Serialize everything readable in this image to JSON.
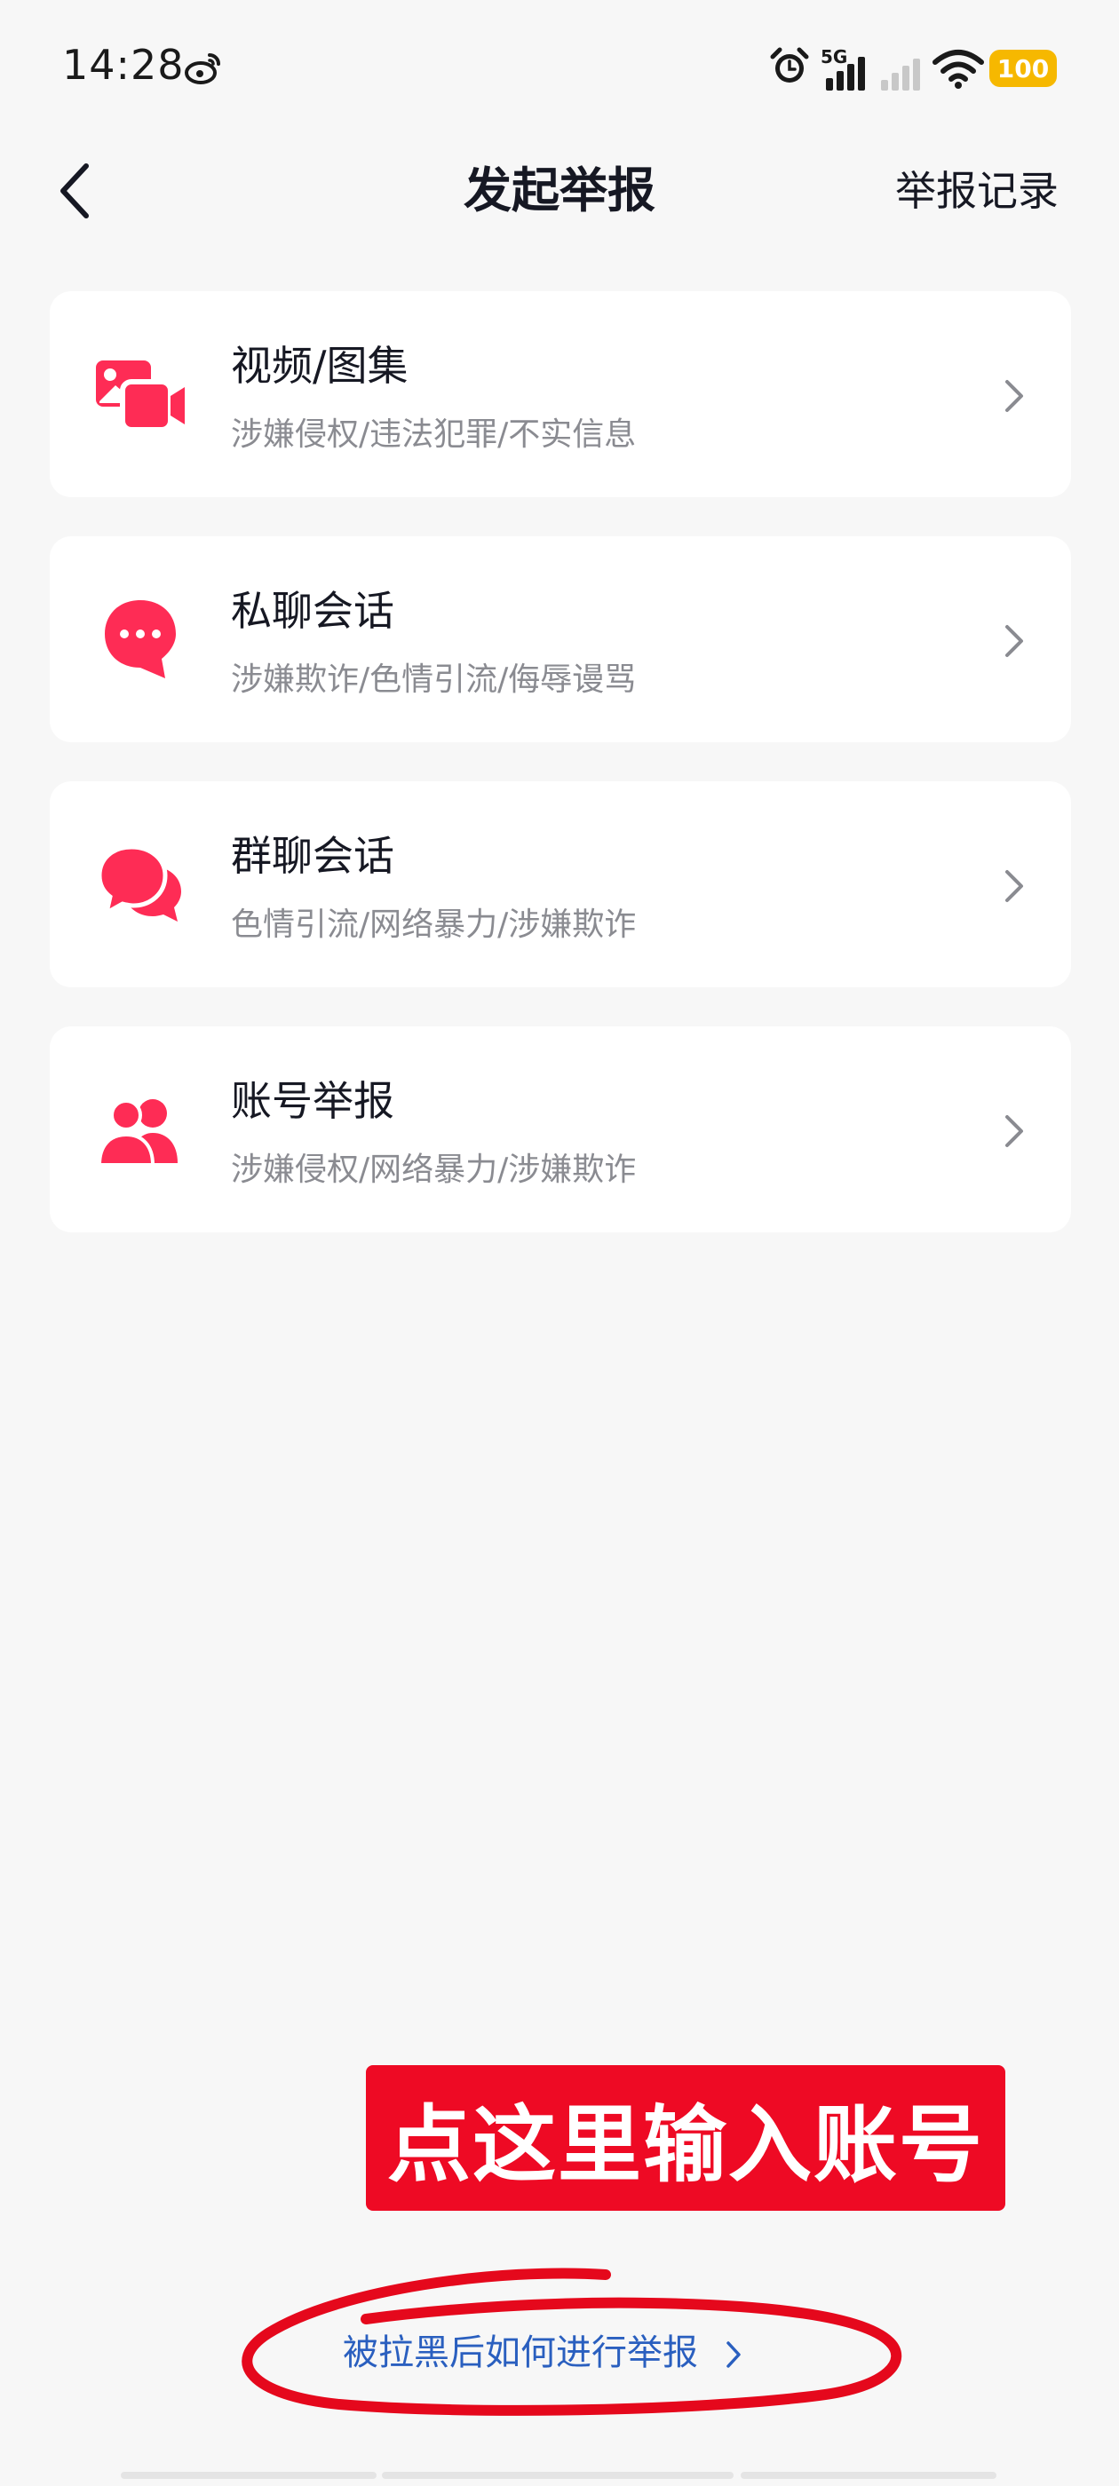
{
  "status_bar": {
    "time": "14:28",
    "network": "5G",
    "battery": "100"
  },
  "header": {
    "title": "发起举报",
    "records_label": "举报记录"
  },
  "report_options": [
    {
      "title": "视频/图集",
      "subtitle": "涉嫌侵权/违法犯罪/不实信息",
      "icon": "video-gallery-icon"
    },
    {
      "title": "私聊会话",
      "subtitle": "涉嫌欺诈/色情引流/侮辱谩骂",
      "icon": "chat-bubble-icon"
    },
    {
      "title": "群聊会话",
      "subtitle": "色情引流/网络暴力/涉嫌欺诈",
      "icon": "group-chat-icon"
    },
    {
      "title": "账号举报",
      "subtitle": "涉嫌侵权/网络暴力/涉嫌欺诈",
      "icon": "users-icon"
    }
  ],
  "annotation": {
    "text": "点这里输入账号"
  },
  "footer": {
    "help_link": "被拉黑后如何进行举报"
  },
  "colors": {
    "accent": "#fe2c55",
    "banner": "#ee0a24",
    "link": "#2a5fbf",
    "battery": "#f6b800"
  }
}
